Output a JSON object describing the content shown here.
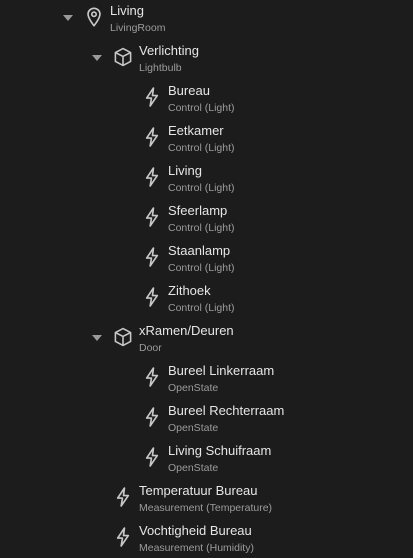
{
  "tree": {
    "items": [
      {
        "level": 0,
        "expandable": true,
        "icon": "location-pin-icon",
        "label": "Living",
        "sub": "LivingRoom"
      },
      {
        "level": 1,
        "expandable": true,
        "icon": "cube-icon",
        "label": "Verlichting",
        "sub": "Lightbulb"
      },
      {
        "level": 2,
        "expandable": false,
        "icon": "lightning-icon",
        "label": "Bureau",
        "sub": "Control (Light)"
      },
      {
        "level": 2,
        "expandable": false,
        "icon": "lightning-icon",
        "label": "Eetkamer",
        "sub": "Control (Light)"
      },
      {
        "level": 2,
        "expandable": false,
        "icon": "lightning-icon",
        "label": "Living",
        "sub": "Control (Light)"
      },
      {
        "level": 2,
        "expandable": false,
        "icon": "lightning-icon",
        "label": "Sfeerlamp",
        "sub": "Control (Light)"
      },
      {
        "level": 2,
        "expandable": false,
        "icon": "lightning-icon",
        "label": "Staanlamp",
        "sub": "Control (Light)"
      },
      {
        "level": 2,
        "expandable": false,
        "icon": "lightning-icon",
        "label": "Zithoek",
        "sub": "Control (Light)"
      },
      {
        "level": 1,
        "expandable": true,
        "icon": "cube-icon",
        "label": "xRamen/Deuren",
        "sub": "Door"
      },
      {
        "level": 2,
        "expandable": false,
        "icon": "lightning-icon",
        "label": "Bureel Linkerraam",
        "sub": "OpenState"
      },
      {
        "level": 2,
        "expandable": false,
        "icon": "lightning-icon",
        "label": "Bureel Rechterraam",
        "sub": "OpenState"
      },
      {
        "level": 2,
        "expandable": false,
        "icon": "lightning-icon",
        "label": "Living Schuifraam",
        "sub": "OpenState"
      },
      {
        "level": 1,
        "expandable": false,
        "icon": "lightning-icon",
        "label": "Temperatuur Bureau",
        "sub": "Measurement (Temperature)"
      },
      {
        "level": 1,
        "expandable": false,
        "icon": "lightning-icon",
        "label": "Vochtigheid Bureau",
        "sub": "Measurement (Humidity)"
      }
    ]
  },
  "colors": {
    "background": "#1c1c1c",
    "label": "#e6e6e6",
    "sublabel": "#9c9c9c",
    "icon": "#c8c8c8",
    "caret": "#9a9a9a"
  }
}
